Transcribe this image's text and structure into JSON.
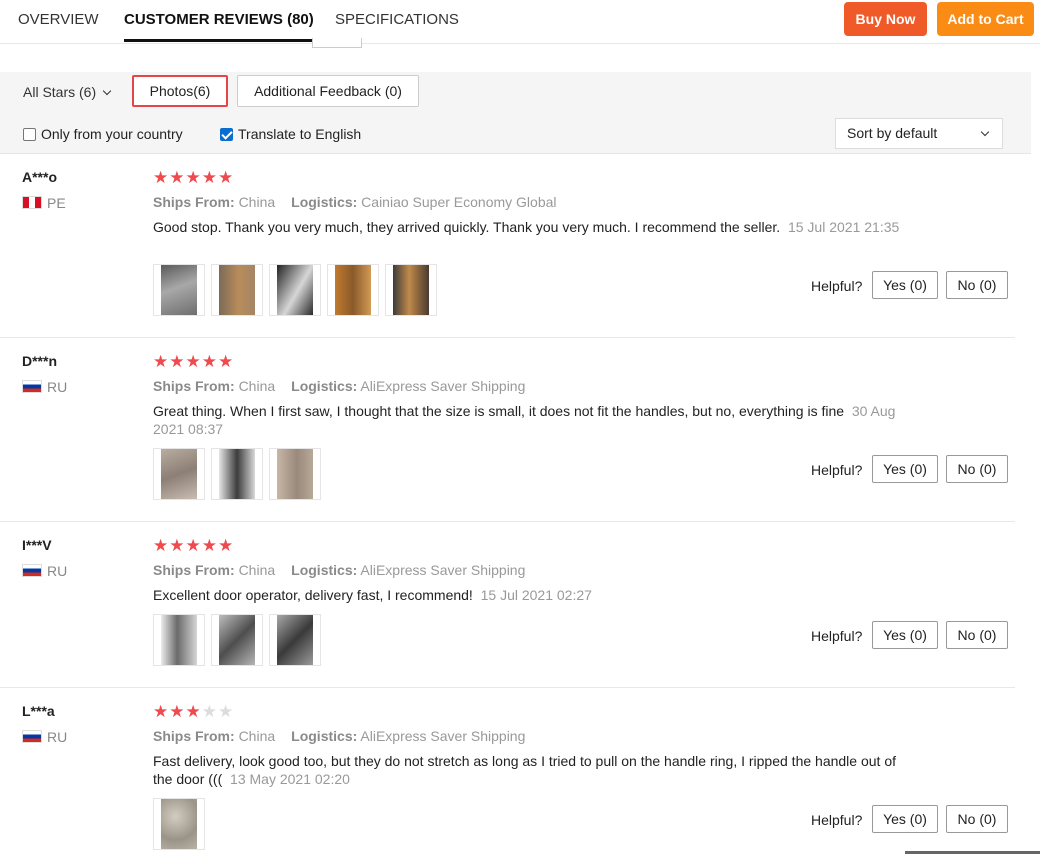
{
  "nav": {
    "tabs": [
      {
        "label": "OVERVIEW"
      },
      {
        "label": "CUSTOMER REVIEWS (80)"
      },
      {
        "label": "SPECIFICATIONS"
      }
    ],
    "buy_now": "Buy Now",
    "add_to_cart": "Add to Cart",
    "colors": {
      "buy_now": "#f05a28",
      "add_to_cart": "#fa8c16"
    }
  },
  "filters": {
    "all_stars": "All Stars (6)",
    "photos": "Photos(6)",
    "additional_feedback": "Additional Feedback (0)",
    "only_country": "Only from your country",
    "only_country_checked": false,
    "translate": "Translate to English",
    "translate_checked": true,
    "sort": "Sort by default"
  },
  "labels": {
    "ships_from": "Ships From:",
    "logistics": "Logistics:",
    "helpful": "Helpful?",
    "yes": "Yes (0)",
    "no": "No (0)"
  },
  "reviews": [
    {
      "user": "A***o",
      "country": "PE",
      "stars": 5,
      "ships_from": "China",
      "logistics": "Cainiao Super Economy Global",
      "text": "Good stop. Thank you very much, they arrived quickly. Thank you very much. I recommend the seller.",
      "date": "15 Jul 2021 21:35",
      "photos": [
        "#7a7a7a",
        "#9c7a55",
        "#3a3a3a",
        "#b57a3c",
        "#6a5848"
      ]
    },
    {
      "user": "D***n",
      "country": "RU",
      "stars": 5,
      "ships_from": "China",
      "logistics": "AliExpress Saver Shipping",
      "text": "Great thing. When I first saw, I thought that the size is small, it does not fit the handles, but no, everything is fine",
      "date": "30 Aug 2021 08:37",
      "photos": [
        "#a89d92",
        "#6d6d6d",
        "#b2a69c"
      ]
    },
    {
      "user": "I***V",
      "country": "RU",
      "stars": 5,
      "ships_from": "China",
      "logistics": "AliExpress Saver Shipping",
      "text": "Excellent door operator, delivery fast, I recommend!",
      "date": "15 Jul 2021 02:27",
      "photos": [
        "#8a8a8a",
        "#9a9a9a",
        "#7d7d7d"
      ]
    },
    {
      "user": "L***a",
      "country": "RU",
      "stars": 3,
      "ships_from": "China",
      "logistics": "AliExpress Saver Shipping",
      "text": "Fast delivery, look good too, but they do not stretch as long as I tried to pull on the handle ring, I ripped the handle out of the door (((",
      "date": "13 May 2021 02:20",
      "photos": [
        "#a09a90"
      ]
    }
  ]
}
